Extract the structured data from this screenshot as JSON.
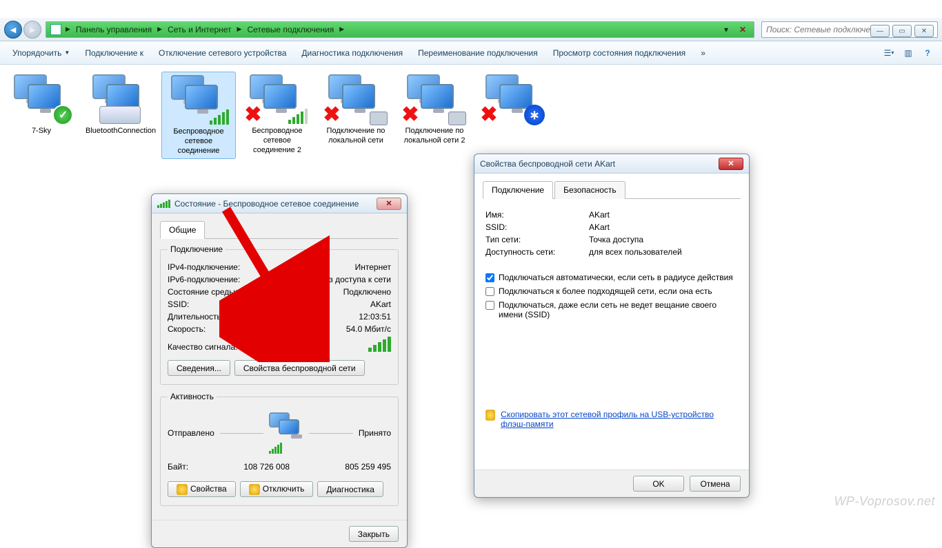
{
  "window_controls": {
    "minimize": "—",
    "maximize": "▭",
    "close": "✕"
  },
  "nav": {
    "breadcrumb": [
      "Панель управления",
      "Сеть и Интернет",
      "Сетевые подключения"
    ],
    "refresh_x": "✕",
    "search_placeholder": "Поиск: Сетевые подключения"
  },
  "toolbar": {
    "items": [
      "Упорядочить",
      "Подключение к",
      "Отключение сетевого устройства",
      "Диагностика подключения",
      "Переименование подключения",
      "Просмотр состояния подключения"
    ],
    "overflow": "»"
  },
  "connections": [
    {
      "label": "7-Sky",
      "overlay": "check"
    },
    {
      "label": "BluetoothConnection",
      "overlay": "modem"
    },
    {
      "label": "Беспроводное сетевое соединение",
      "overlay": "signal",
      "selected": true
    },
    {
      "label": "Беспроводное сетевое соединение 2",
      "overlay": "x-signal"
    },
    {
      "label": "Подключение по локальной сети",
      "overlay": "x-cable"
    },
    {
      "label": "Подключение по локальной сети 2",
      "overlay": "x-cable"
    },
    {
      "label": "",
      "overlay": "x-bt"
    }
  ],
  "status_dialog": {
    "title": "Состояние - Беспроводное сетевое соединение",
    "tab_general": "Общие",
    "group_connection": "Подключение",
    "rows": {
      "ipv4_k": "IPv4-подключение:",
      "ipv4_v": "Интернет",
      "ipv6_k": "IPv6-подключение:",
      "ipv6_v": "Без доступа к сети",
      "media_k": "Состояние среды:",
      "media_v": "Подключено",
      "ssid_k": "SSID:",
      "ssid_v": "AKart",
      "dur_k": "Длительность:",
      "dur_v": "12:03:51",
      "speed_k": "Скорость:",
      "speed_v": "54.0 Мбит/с",
      "quality_k": "Качество сигнала:"
    },
    "btn_details": "Сведения...",
    "btn_wprops": "Свойства беспроводной сети",
    "group_activity": "Активность",
    "sent": "Отправлено",
    "received": "Принято",
    "bytes_k": "Байт:",
    "bytes_sent": "108 726 008",
    "bytes_recv": "805 259 495",
    "btn_props": "Свойства",
    "btn_disable": "Отключить",
    "btn_diag": "Диагностика",
    "btn_close": "Закрыть"
  },
  "props_dialog": {
    "title": "Свойства беспроводной сети AKart",
    "tab_connection": "Подключение",
    "tab_security": "Безопасность",
    "name_k": "Имя:",
    "name_v": "AKart",
    "ssid_k": "SSID:",
    "ssid_v": "AKart",
    "type_k": "Тип сети:",
    "type_v": "Точка доступа",
    "avail_k": "Доступность сети:",
    "avail_v": "для всех пользователей",
    "chk_auto": "Подключаться автоматически, если сеть в радиусе действия",
    "chk_better": "Подключаться к более подходящей сети, если она есть",
    "chk_hidden": "Подключаться, даже если сеть не ведет вещание своего имени (SSID)",
    "copy_link": "Скопировать этот сетевой профиль на USB-устройство флэш-памяти",
    "btn_ok": "OK",
    "btn_cancel": "Отмена"
  },
  "watermark": "WP-Voprosov.net"
}
